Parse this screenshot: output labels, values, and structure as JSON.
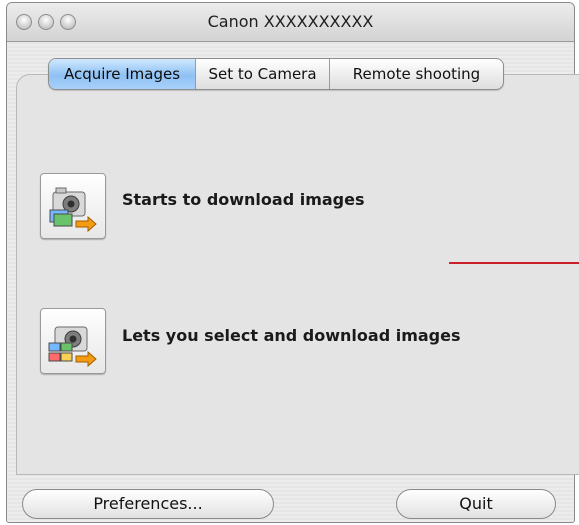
{
  "window": {
    "title": "Canon XXXXXXXXXX"
  },
  "tabs": [
    {
      "label": "Acquire Images",
      "active": true
    },
    {
      "label": "Set to Camera",
      "active": false
    },
    {
      "label": "Remote shooting",
      "active": false
    }
  ],
  "actions": [
    {
      "label": "Starts to download images",
      "icon": "camera-download-icon"
    },
    {
      "label": "Lets you select and download images",
      "icon": "camera-select-download-icon"
    }
  ],
  "buttons": {
    "preferences": "Preferences...",
    "quit": "Quit"
  },
  "colors": {
    "active_tab": "#8fc1f4",
    "annotation_line": "#cc1f2a"
  }
}
